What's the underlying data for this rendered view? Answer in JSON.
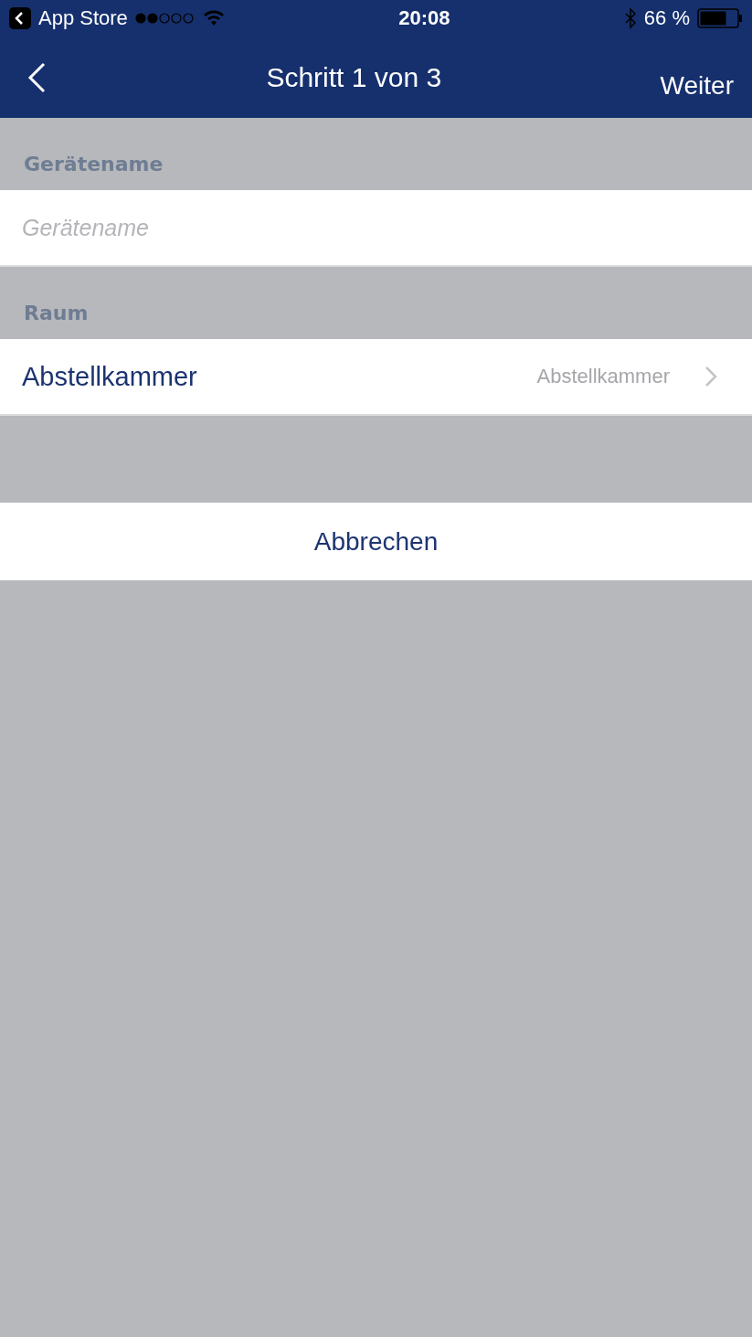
{
  "status_bar": {
    "back_app": "App Store",
    "time": "20:08",
    "battery": "66 %"
  },
  "nav_bar": {
    "title": "Schritt 1 von 3",
    "next": "Weiter"
  },
  "sections": [
    {
      "header": "Gerätename",
      "kind": "input",
      "placeholder": "Gerätename"
    },
    {
      "header": "Raum",
      "kind": "picker",
      "label": "Abstellkammer",
      "value": "Abstellkammer"
    }
  ],
  "cancel": "Abbrechen"
}
